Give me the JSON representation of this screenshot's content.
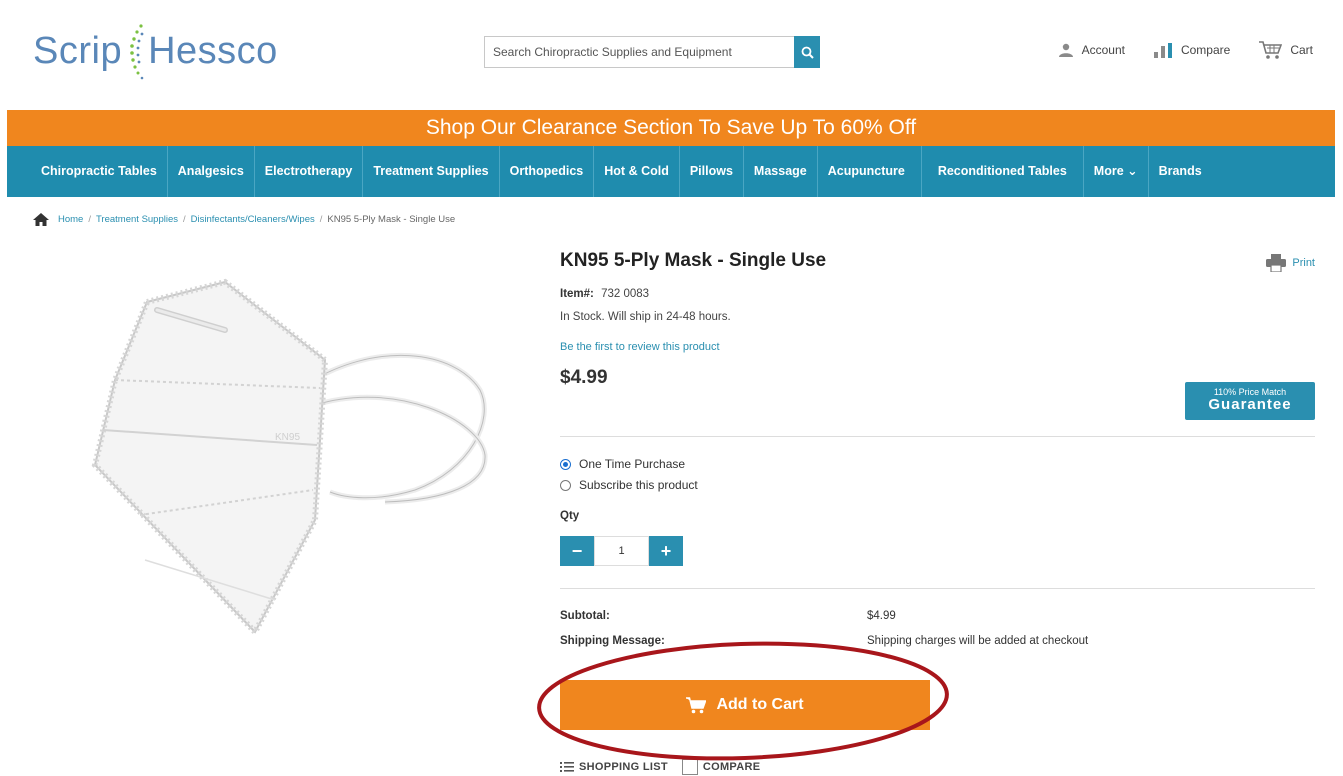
{
  "header": {
    "logo_left": "Scrip",
    "logo_right": "Hessco",
    "search_placeholder": "Search Chiropractic Supplies and Equipment",
    "account_label": "Account",
    "compare_label": "Compare",
    "cart_label": "Cart"
  },
  "promo": {
    "text": "Shop Our Clearance Section To Save Up To 60% Off",
    "color": "#f0861e"
  },
  "nav": {
    "items": [
      {
        "label": "Chiropractic Tables"
      },
      {
        "label": "Analgesics"
      },
      {
        "label": "Electrotherapy"
      },
      {
        "label": "Treatment Supplies"
      },
      {
        "label": "Orthopedics"
      },
      {
        "label": "Hot & Cold"
      },
      {
        "label": "Pillows"
      },
      {
        "label": "Massage"
      },
      {
        "label": "Acupuncture"
      },
      {
        "label": "Reconditioned Tables"
      },
      {
        "label": "More ⌄"
      },
      {
        "label": "Brands"
      }
    ],
    "color": "#1f8cae"
  },
  "breadcrumb": {
    "home": "Home",
    "sep": "/",
    "level1": "Treatment Supplies",
    "level2": "Disinfectants/Cleaners/Wipes",
    "current": "KN95 5-Ply Mask - Single Use"
  },
  "product": {
    "title": "KN95 5-Ply Mask - Single Use",
    "print_label": "Print",
    "item_label": "Item#:",
    "item_number": "732 0083",
    "stock": "In Stock. Will ship in 24-48 hours.",
    "review_link": "Be the first to review this product",
    "price": "$4.99",
    "guarantee_top": "110% Price Match",
    "guarantee_bottom": "Guarantee",
    "image_text": "KN95"
  },
  "purchase": {
    "option_one_time": "One Time Purchase",
    "option_subscribe": "Subscribe this product",
    "selected": "One Time Purchase",
    "qty_label": "Qty",
    "qty_value": "1",
    "minus": "−",
    "plus": "+"
  },
  "summary": {
    "subtotal_label": "Subtotal:",
    "subtotal_value": "$4.99",
    "shipping_label": "Shipping Message:",
    "shipping_value": "Shipping charges will be added at checkout"
  },
  "actions": {
    "add_to_cart": "Add to Cart",
    "shopping_list": "SHOPPING LIST",
    "compare": "COMPARE"
  },
  "colors": {
    "accent_blue": "#2a8fb0",
    "accent_orange": "#f0861e",
    "annotation_red": "#a8161b"
  }
}
